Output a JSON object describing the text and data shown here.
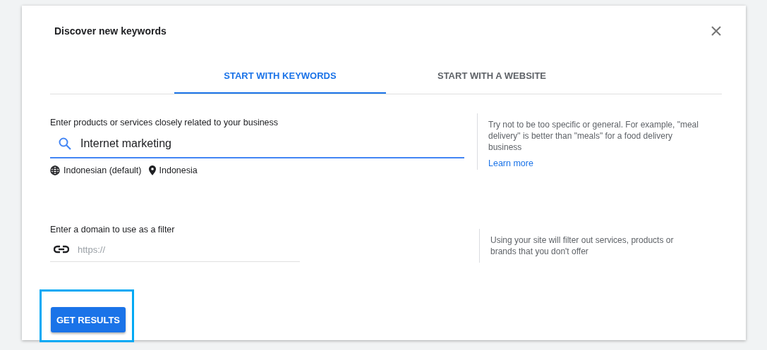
{
  "dialog": {
    "title": "Discover new keywords"
  },
  "tabs": [
    {
      "label": "START WITH KEYWORDS",
      "selected": true
    },
    {
      "label": "START WITH A WEBSITE",
      "selected": false
    }
  ],
  "keywords_section": {
    "label": "Enter products or services closely related to your business",
    "value": "Internet marketing",
    "language": "Indonesian (default)",
    "location": "Indonesia",
    "hint": "Try not to be too specific or general. For example, \"meal delivery\" is better than \"meals\" for a food delivery business",
    "link": "Learn more"
  },
  "domain_section": {
    "label": "Enter a domain to use as a filter",
    "placeholder": "https://",
    "hint": "Using your site will filter out services, products or brands that you don't offer"
  },
  "button": {
    "label": "GET RESULTS",
    "highlighted": true
  }
}
